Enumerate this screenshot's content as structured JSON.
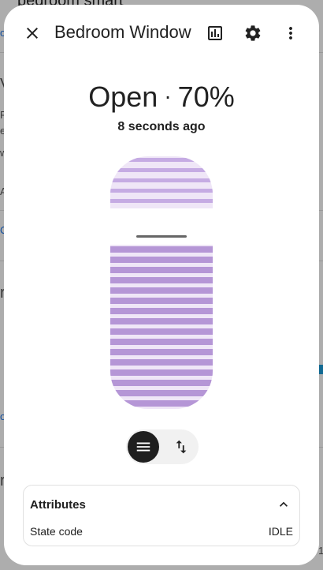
{
  "background": {
    "page_title": "bedroom smart",
    "fragments": [
      "or",
      "V",
      "P",
      "e",
      "w",
      "A",
      "C",
      "r",
      "o",
      "r",
      "1"
    ]
  },
  "dialog": {
    "title": "Bedroom Window",
    "state": "Open",
    "position": "70%",
    "position_value": 70,
    "last_changed": "8 seconds ago",
    "accent_color": "#b596d6",
    "toolbar_icons": [
      "close-icon",
      "history-chart-icon",
      "settings-gear-icon",
      "more-vertical-icon"
    ],
    "mode_toggle": {
      "options": [
        "position-mode",
        "open-close-mode"
      ],
      "selected": "position-mode"
    },
    "attributes": {
      "title": "Attributes",
      "expanded": true,
      "rows": [
        {
          "key": "State code",
          "value": "IDLE"
        }
      ]
    }
  }
}
